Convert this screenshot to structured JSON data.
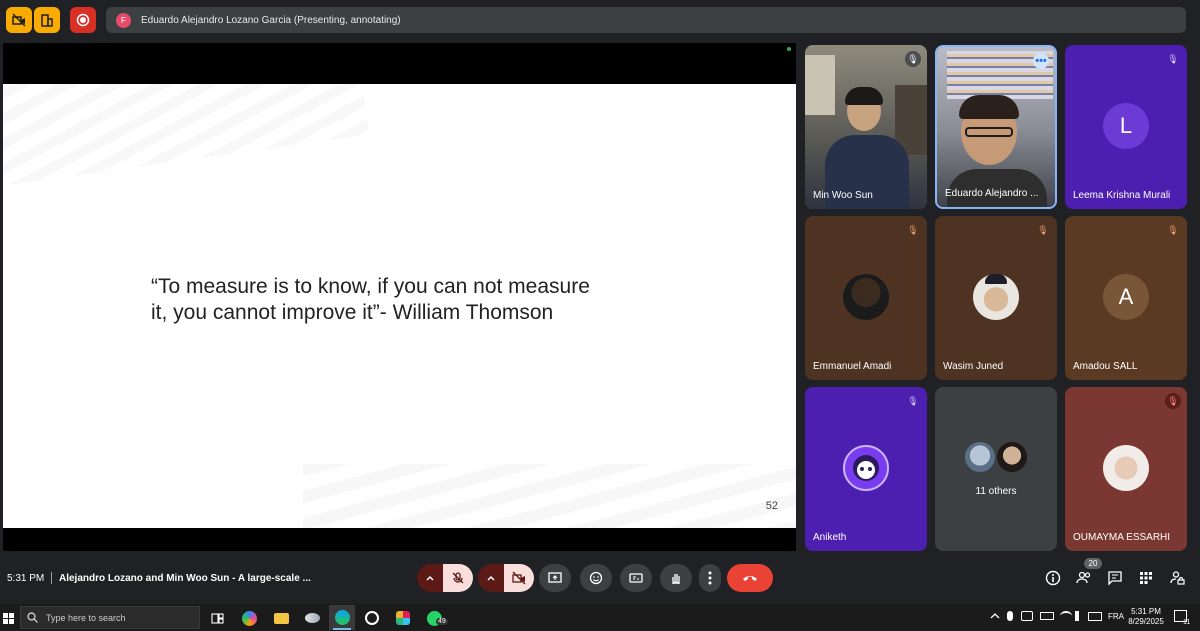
{
  "top_bar": {
    "presenter_initial": "F",
    "presenter_text": "Eduardo Alejandro Lozano Garcia (Presenting, annotating)"
  },
  "slide": {
    "quote_line1": "“To measure is to know, if you can not measure",
    "quote_line2": "it, you cannot improve it”- William Thomson",
    "page_number": "52"
  },
  "participants": [
    {
      "name": "Min Woo Sun",
      "type": "video"
    },
    {
      "name": "Eduardo Alejandro ...",
      "type": "video"
    },
    {
      "name": "Leema Krishna Murali",
      "initial": "L",
      "type": "initial"
    },
    {
      "name": "Emmanuel Amadi",
      "type": "photo"
    },
    {
      "name": "Wasim Juned",
      "type": "photo"
    },
    {
      "name": "Amadou SALL",
      "initial": "A",
      "type": "initial"
    },
    {
      "name": "Aniketh",
      "type": "photo"
    },
    {
      "name": "11 others",
      "type": "others"
    },
    {
      "name": "OUMAYMA ESSARHI",
      "type": "photo"
    }
  ],
  "bottom_bar": {
    "time": "5:31 PM",
    "meeting_title": "Alejandro Lozano and Min Woo Sun - A large-scale ...",
    "participant_count": "20"
  },
  "taskbar": {
    "search_placeholder": "Type here to search",
    "whatsapp_badge": "49",
    "language": "FRA",
    "clock_time": "5:31 PM",
    "clock_date": "8/29/2025",
    "notification_count": "11"
  },
  "colors": {
    "background": "#202124",
    "accent_yellow": "#f9ab00",
    "record_red": "#d93025",
    "end_call_red": "#ea4335",
    "tile_purple": "#4d1fb0",
    "tile_brown": "#5a3a22"
  }
}
